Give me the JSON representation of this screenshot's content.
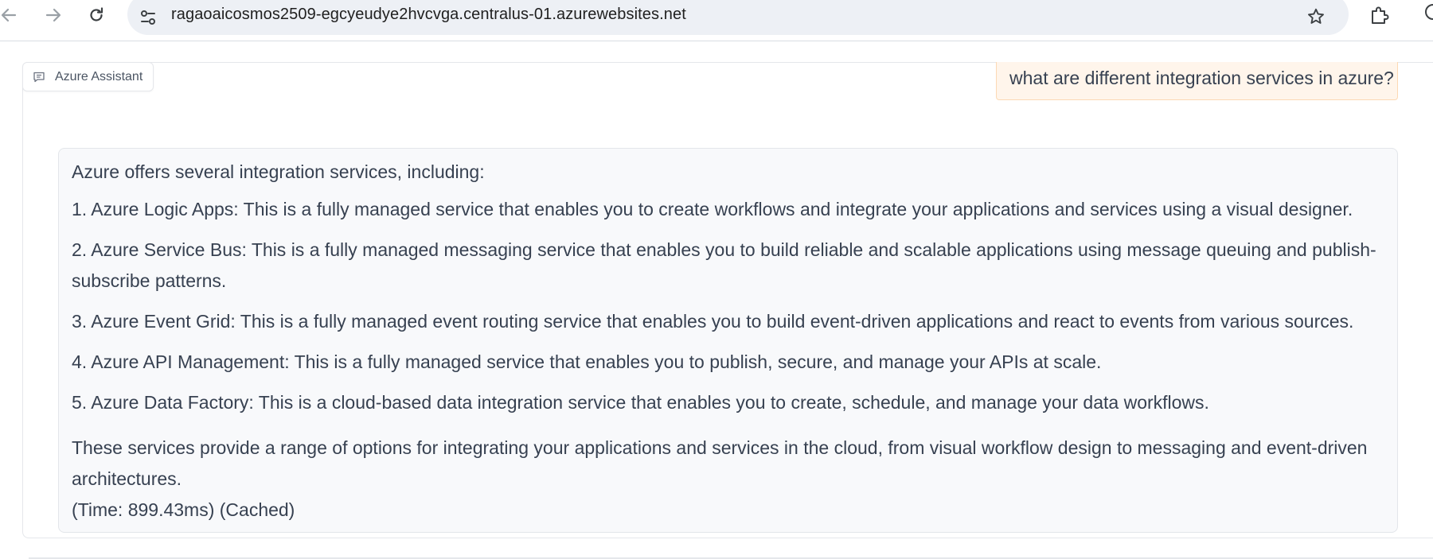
{
  "browser": {
    "url": "ragaoaicosmos2509-egcyeudye2hvcvga.centralus-01.azurewebsites.net",
    "icons": {
      "back": "arrow-left-icon",
      "forward": "arrow-right-icon",
      "reload": "reload-icon",
      "site_info": "site-settings-icon",
      "bookmark": "star-icon",
      "extensions": "puzzle-icon"
    }
  },
  "chat": {
    "tab_label": "Azure Assistant",
    "user_message": "what are different integration services in azure?",
    "response": {
      "intro": "Azure offers several integration services, including:",
      "items": [
        "1. Azure Logic Apps: This is a fully managed service that enables you to create workflows and integrate your applications and services using a visual designer.",
        "2. Azure Service Bus: This is a fully managed messaging service that enables you to build reliable and scalable applications using message queuing and publish-subscribe patterns.",
        "3. Azure Event Grid: This is a fully managed event routing service that enables you to build event-driven applications and react to events from various sources.",
        "4. Azure API Management: This is a fully managed service that enables you to publish, secure, and manage your APIs at scale.",
        "5. Azure Data Factory: This is a cloud-based data integration service that enables you to create, schedule, and manage your data workflows."
      ],
      "summary": "These services provide a range of options for integrating your applications and services in the cloud, from visual workflow design to messaging and event-driven architectures.",
      "timing": "(Time: 899.43ms) (Cached)"
    }
  },
  "colors": {
    "user_bubble_bg": "#fff5eb",
    "user_bubble_border": "#fcd9b4",
    "bot_bubble_bg": "#f8f9fb",
    "text": "#374151",
    "omnibox_bg": "#edf0f5"
  }
}
